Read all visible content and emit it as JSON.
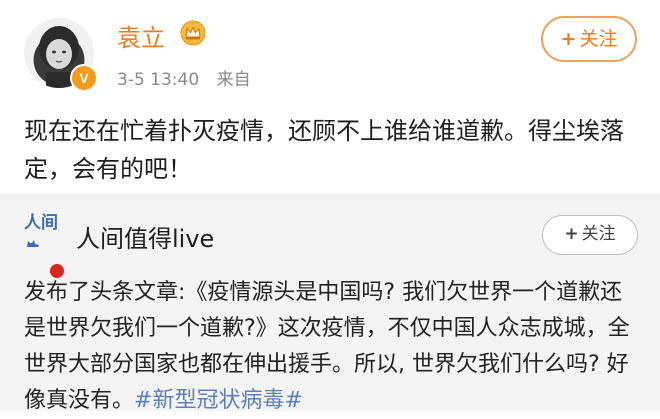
{
  "post": {
    "author": "袁立",
    "date": "3-5 13:40",
    "source": "来自",
    "follow_label": "关注",
    "follow_plus": "+",
    "text": "现在还在忙着扑灭疫情，还顾不上谁给谁道歉。得尘埃落定，会有的吧！",
    "colors": {
      "author": "#ea7a1b",
      "badge": "#f59a1b"
    },
    "icons": [
      "avatar",
      "verified-badge",
      "crown-icon"
    ]
  },
  "repost": {
    "logo_text": "人间",
    "source_name": "人间值得live",
    "follow_label": "关注",
    "follow_plus": "+",
    "text": "发布了头条文章:《疫情源头是中国吗? 我们欠世界一个道歉还是世界欠我们一个道歉?》这次疫情，不仅中国人众志成城，全世界大部分国家也都在伸出援手。所以, 世界欠我们什么吗? 好像真没有。",
    "hashtag": "#新型冠状病毒#",
    "colors": {
      "hashtag": "#5b7fb8",
      "card_bg": "#f4f4f4"
    }
  }
}
